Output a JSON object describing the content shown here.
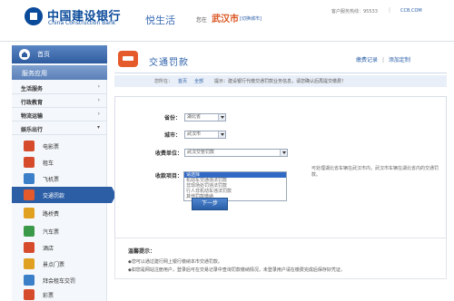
{
  "header": {
    "logo_cn": "中国建设银行",
    "logo_en": "China Construction Bank",
    "portal_name": "悦生活",
    "location_prefix": "您在",
    "city": "武汉市",
    "switch_city": "[切换城市]",
    "hotline": "客户服务热线：95533",
    "separator": "|",
    "site_link": "CCB.COM"
  },
  "sidebar": {
    "home": "首页",
    "services_header": "服务应用",
    "categories": [
      {
        "label": "生活服务",
        "arrow": "›"
      },
      {
        "label": "行政教育",
        "arrow": "›"
      },
      {
        "label": "物流运输",
        "arrow": "›"
      },
      {
        "label": "娱乐出行",
        "arrow": "▾"
      }
    ],
    "subitems": [
      {
        "label": "电影票",
        "color": "#d64b2c",
        "icon": "movie-ticket-icon"
      },
      {
        "label": "租车",
        "color": "#d64b2c",
        "icon": "car-rental-icon"
      },
      {
        "label": "飞机票",
        "color": "#3b7fc8",
        "icon": "plane-icon"
      },
      {
        "label": "交通罚款",
        "color": "#e55a2b",
        "icon": "traffic-fine-icon"
      },
      {
        "label": "路桥费",
        "color": "#e0a020",
        "icon": "road-bridge-icon"
      },
      {
        "label": "汽车票",
        "color": "#3b9a4a",
        "icon": "bus-ticket-icon"
      },
      {
        "label": "酒店",
        "color": "#d64b2c",
        "icon": "hotel-icon"
      },
      {
        "label": "景点门票",
        "color": "#e0a020",
        "icon": "attraction-ticket-icon"
      },
      {
        "label": "拜会租车交罚",
        "color": "#3b7fc8",
        "icon": "rental-fine-icon"
      },
      {
        "label": "彩票",
        "color": "#d64b2c",
        "icon": "lottery-icon"
      }
    ]
  },
  "main": {
    "title": "交通罚款",
    "links": [
      "缴费记录",
      "|",
      "添加定制"
    ],
    "notice_prefix": "您所在：",
    "notice_links": [
      "首页",
      "全部"
    ],
    "notice_text": "提示：建设银行代缴交通罚款业务信息，请您确认后再提交缴费！",
    "form": {
      "province_label": "省份：",
      "province_value": "湖北省",
      "city_label": "城市：",
      "city_value": "武汉市",
      "unit_label": "收费单位：",
      "unit_value": "武汉交管罚款",
      "item_label": "收款项目：",
      "item_options": [
        "请选择",
        "机动车交通违法罚款",
        "非现场处罚违法罚款",
        "行人非机动车违法罚款",
        "其他罚款缴纳"
      ],
      "item_selected": 0,
      "hint": "可处理湖北省车辆在武汉市内，武汉市车辆在湖北省内的交通罚款。",
      "next_button": "下一步"
    },
    "tips": {
      "title": "温馨提示：",
      "lines": [
        "◆您可以通过建行网上银行缴纳本市交通罚款。",
        "◆如您是网站注册用户，登录后可在交易记录中查询罚款缴纳情况，未登录用户请在缴费完成后保存好凭证。"
      ]
    }
  }
}
